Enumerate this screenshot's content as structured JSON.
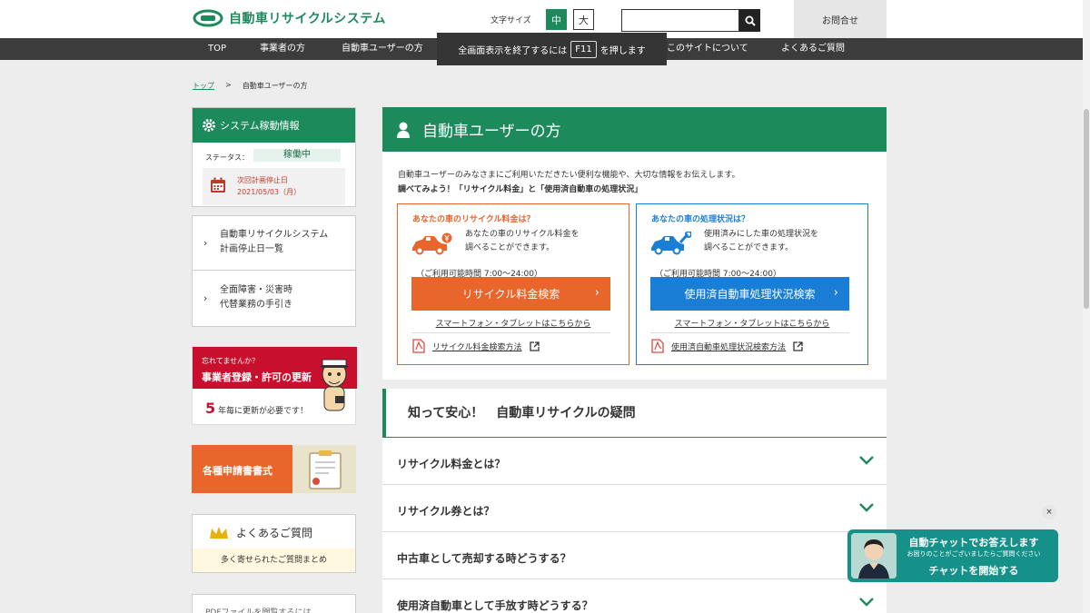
{
  "header": {
    "logo_text": "自動車リサイクルシステム",
    "font_size_label": "文字サイズ",
    "font_size_medium": "中",
    "font_size_large": "大",
    "search_placeholder": "",
    "contact_label": "お問合せ"
  },
  "nav": {
    "items": [
      "TOP",
      "事業者の方",
      "自動車ユーザーの方",
      "このサイトについて",
      "よくあるご質問"
    ]
  },
  "overlay": {
    "text_before": "全画面表示を終了するには",
    "key": "F11",
    "text_after": "を押します"
  },
  "breadcrumb": {
    "home": "トップ",
    "separator": ">",
    "current": "自動車ユーザーの方"
  },
  "system_status": {
    "title": "システム稼動情報",
    "status_label": "ステータス：",
    "status_value": "稼働中",
    "next_stop_label": "次回計画停止日",
    "next_stop_date": "2021/05/03（月）"
  },
  "sidebar_links": [
    {
      "line1": "自動車リサイクルシステム",
      "line2": "計画停止日一覧"
    },
    {
      "line1": "全面障害・災害時",
      "line2": "代替業務の手引き"
    }
  ],
  "banner_renew": {
    "small": "忘れてませんか？",
    "title": "事業者登録・許可の更新",
    "number": "5",
    "note": "年毎に更新が必要です！"
  },
  "banner_forms": {
    "label": "各種申請書書式"
  },
  "banner_faq": {
    "title": "よくあるご質問",
    "subtitle": "多く寄せられたご質問まとめ"
  },
  "banner_pdf": {
    "label": "PDFファイルを閲覧するには"
  },
  "main": {
    "title": "自動車ユーザーの方",
    "intro": "自動車ユーザーのみなさまにご利用いただきたい便利な機能や、大切な情報をお伝えします。",
    "intro_bold": "調べてみよう！「リサイクル料金」と「使用済自動車の処理状況」",
    "cards": [
      {
        "title": "あなたの車のリサイクル料金は？",
        "desc1": "あなたの車のリサイクル料金を",
        "desc2": "調べることができます。",
        "hours": "（ご利用可能時間 7:00〜24:00）",
        "button": "リサイクル料金検索",
        "smartphone": "スマートフォン・タブレットはこちらから",
        "pdf_link": "リサイクル料金検索方法"
      },
      {
        "title": "あなたの車の処理状況は？",
        "desc1": "使用済みにした車の処理状況を",
        "desc2": "調べることができます。",
        "hours": "（ご利用可能時間 7:00〜24:00）",
        "button": "使用済自動車処理状況検索",
        "smartphone": "スマートフォン・タブレットはこちらから",
        "pdf_link": "使用済自動車処理状況検索方法"
      }
    ]
  },
  "faq": {
    "title": "知って安心！　自動車リサイクルの疑問",
    "questions": [
      "リサイクル料金とは？",
      "リサイクル券とは？",
      "中古車として売却する時どうする？",
      "使用済自動車として手放す時どうする？"
    ]
  },
  "chat": {
    "close": "×",
    "title": "自動チャットでお答えします",
    "subtitle": "お困りのことがございましたらご質問ください",
    "start": "チャットを開始する"
  },
  "colors": {
    "brand_green": "#1d8a5c",
    "orange": "#e8662c",
    "blue": "#1a7ed6",
    "red": "#c8102e"
  }
}
